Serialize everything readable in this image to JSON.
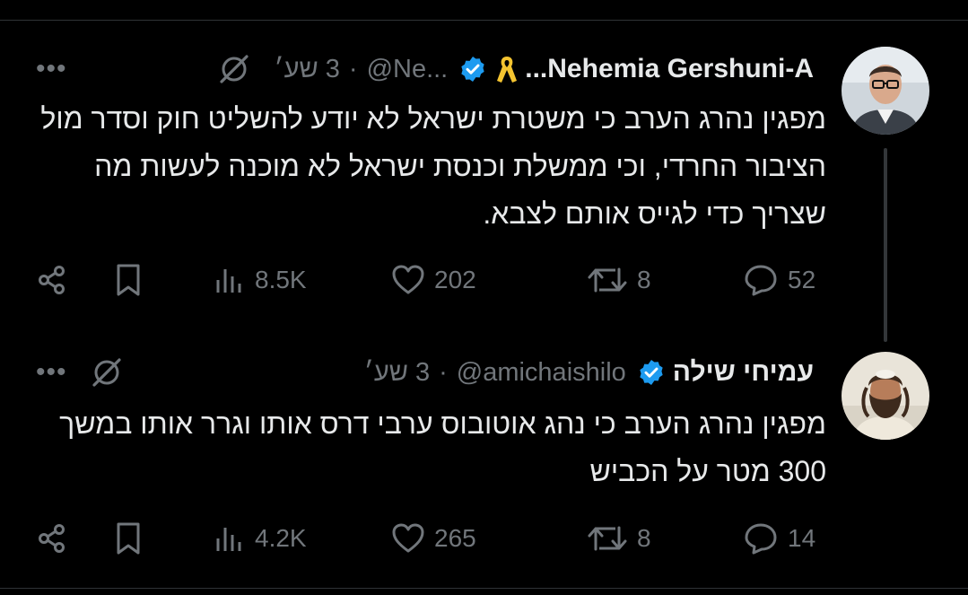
{
  "tweets": [
    {
      "name": "Nehemia Gershuni-A...",
      "handle": "@Ne...",
      "time": "3 שע׳",
      "separator": "·",
      "more": "•••",
      "text": "מפגין נהרג הערב כי משטרת ישראל לא יודע להשליט חוק וסדר מול הציבור החרדי, וכי ממשלת וכנסת ישראל לא מוכנה לעשות מה שצריך כדי לגייס אותם לצבא.",
      "replies": "52",
      "reposts": "8",
      "likes": "202",
      "views": "8.5K"
    },
    {
      "name": "עמיחי שילה",
      "handle": "@amichaishilo",
      "time": "3 שע׳",
      "separator": "·",
      "more": "•••",
      "text": "מפגין נהרג הערב כי נהג אוטובוס ערבי דרס אותו וגרר אותו במשך 300 מטר על הכביש",
      "replies": "14",
      "reposts": "8",
      "likes": "265",
      "views": "4.2K"
    }
  ],
  "colors": {
    "background": "#000000",
    "text": "#e7e9ea",
    "muted": "#71767b",
    "verified": "#1d9bf0",
    "ribbon": "#f4c430"
  }
}
